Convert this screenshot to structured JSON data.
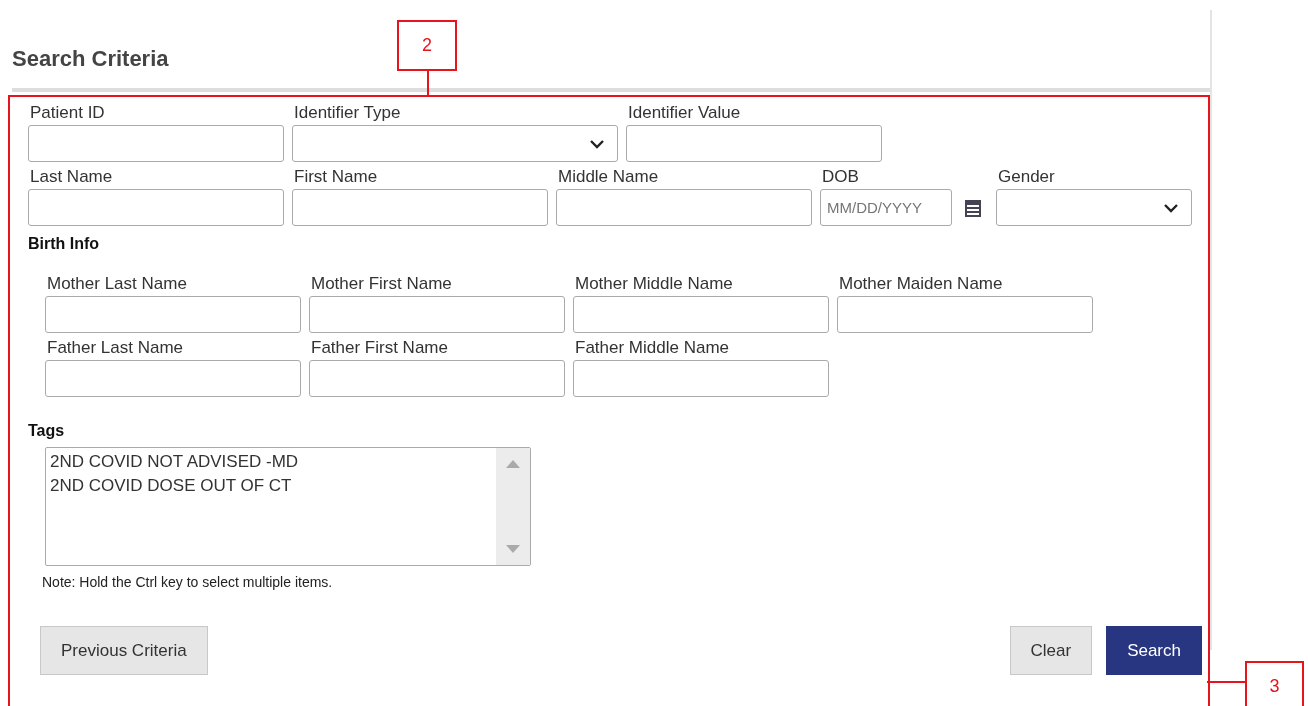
{
  "title": "Search Criteria",
  "callouts": [
    {
      "label": "2"
    },
    {
      "label": "3"
    }
  ],
  "main_fields": [
    [
      {
        "kind": "text",
        "label": "Patient ID"
      },
      {
        "kind": "select",
        "label": "Identifier Type"
      },
      {
        "kind": "text",
        "label": "Identifier Value"
      }
    ],
    [
      {
        "kind": "text",
        "label": "Last Name"
      },
      {
        "kind": "text",
        "label": "First Name"
      },
      {
        "kind": "text",
        "label": "Middle Name"
      },
      {
        "kind": "date",
        "label": "DOB",
        "placeholder": "MM/DD/YYYY"
      },
      {
        "kind": "select",
        "label": "Gender"
      }
    ]
  ],
  "birth_info": {
    "heading": "Birth Info",
    "rows": [
      [
        {
          "label": "Mother Last Name"
        },
        {
          "label": "Mother First Name"
        },
        {
          "label": "Mother Middle Name"
        },
        {
          "label": "Mother Maiden Name"
        }
      ],
      [
        {
          "label": "Father Last Name"
        },
        {
          "label": "Father First Name"
        },
        {
          "label": "Father Middle Name"
        }
      ]
    ]
  },
  "tags": {
    "heading": "Tags",
    "items": [
      {
        "label": "2ND COVID NOT ADVISED -MD",
        "selected": false
      },
      {
        "label": "2ND COVID DOSE OUT OF CT",
        "selected": false
      }
    ],
    "note": "Note: Hold the Ctrl key to select multiple items."
  },
  "buttons": [
    {
      "kind": "secondary",
      "label": "Previous Criteria"
    },
    {
      "kind": "secondary",
      "label": "Clear"
    },
    {
      "kind": "primary",
      "label": "Search"
    }
  ]
}
